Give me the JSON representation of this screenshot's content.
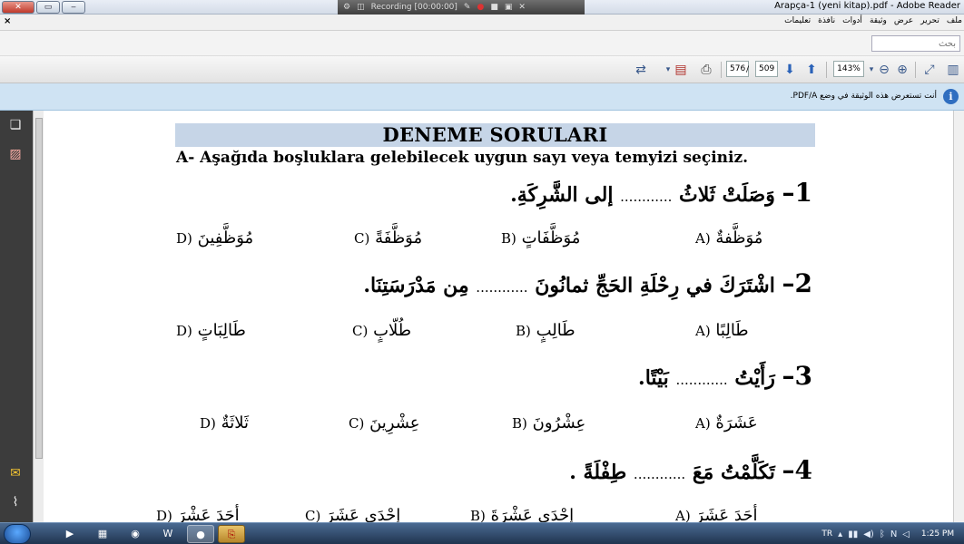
{
  "window": {
    "title": "Arapça-1 (yeni kitap).pdf - Adobe Reader",
    "recording_label": "Recording [00:00:00]"
  },
  "menu": {
    "close_glyph": "×",
    "items": [
      "ملف",
      "تحرير",
      "عرض",
      "وثيقة",
      "أدوات",
      "نافذة",
      "تعليمات"
    ]
  },
  "search": {
    "placeholder": "بحث"
  },
  "toolbar": {
    "current_page": "576",
    "page_separator": "/",
    "total_pages": "509",
    "zoom": "143%"
  },
  "infobar": {
    "message": "أنت تستعرض هذه الوثيقة في وضع PDF/A."
  },
  "document": {
    "header": "DENEME SORULARI",
    "instruction": "A-  Aşağıda boşluklara gelebilecek uygun sayı veya temyizi seçiniz.",
    "questions": [
      {
        "number": "1–",
        "before": "وَصَلَتْ ثَلاثُ",
        "dots": "............",
        "after": "إلى الشَّرِكَةِ.",
        "options": [
          {
            "label": "A)",
            "text": "مُوَظَّفةٌ"
          },
          {
            "label": "B)",
            "text": "مُوَظَّفَاتٍ"
          },
          {
            "label": "C)",
            "text": "مُوَظَّفَةً"
          },
          {
            "label": "D)",
            "text": "مُوَظَّفِينَ"
          }
        ]
      },
      {
        "number": "2–",
        "before": "اشْتَرَكَ في رِحْلَةِ الحَجِّ ثمانُونَ",
        "dots": "............",
        "after": "مِن مَدْرَسَتِنَا.",
        "options": [
          {
            "label": "A)",
            "text": "طَالِبًا"
          },
          {
            "label": "B)",
            "text": "طَالِبٍ"
          },
          {
            "label": "C)",
            "text": "طُلّابٍ"
          },
          {
            "label": "D)",
            "text": "طَالِبَاتٍ"
          }
        ]
      },
      {
        "number": "3–",
        "before": "رَأَيْتُ",
        "dots": "............",
        "after": "بَيْتًا.",
        "options": [
          {
            "label": "A)",
            "text": "عَشَرَةٌ"
          },
          {
            "label": "B)",
            "text": "عِشْرُونَ"
          },
          {
            "label": "C)",
            "text": "عِشْرِينَ"
          },
          {
            "label": "D)",
            "text": "ثَلاثَةٌ"
          }
        ]
      },
      {
        "number": "4–",
        "before": "تَكَلَّمْتُ مَعَ",
        "dots": "............",
        "after": "طِفْلَةً .",
        "options": [
          {
            "label": "A)",
            "text": "أحَدَ عَشَرَ"
          },
          {
            "label": "B)",
            "text": "إحْدَى عَشْرَةَ"
          },
          {
            "label": "C)",
            "text": "إحْدَى عَشَرَ"
          },
          {
            "label": "D)",
            "text": "أحَدَ عَشْرَ"
          }
        ]
      }
    ]
  },
  "taskbar": {
    "lang": "TR",
    "clock": "1:25 PM"
  }
}
